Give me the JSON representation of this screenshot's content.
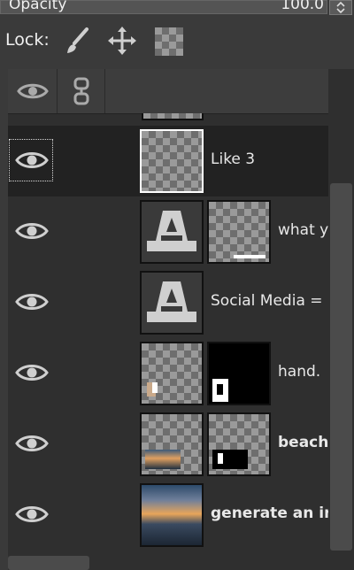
{
  "opacity": {
    "label": "Opacity",
    "value": "100.0",
    "spin": "⌃⌄"
  },
  "lock": {
    "label": "Lock:"
  },
  "layers": [
    {
      "name": "",
      "thumb": "checker"
    },
    {
      "name": "Like 3",
      "thumb": "checker",
      "selected": true
    },
    {
      "name": "what y",
      "thumb": "text",
      "mask": "checker-bar"
    },
    {
      "name": "Social Media =",
      "thumb": "text"
    },
    {
      "name": "hand.",
      "thumb": "checker-hand",
      "mask": "black-mask"
    },
    {
      "name": "beach",
      "thumb": "checker-beach",
      "mask": "checker-mask",
      "bold": true
    },
    {
      "name": "generate an ir",
      "thumb": "photo",
      "bold": true
    }
  ],
  "colors": {
    "panel_bg": "#2f2f2f",
    "selected_row": "#222222",
    "header_bg": "#3d3d3d"
  }
}
